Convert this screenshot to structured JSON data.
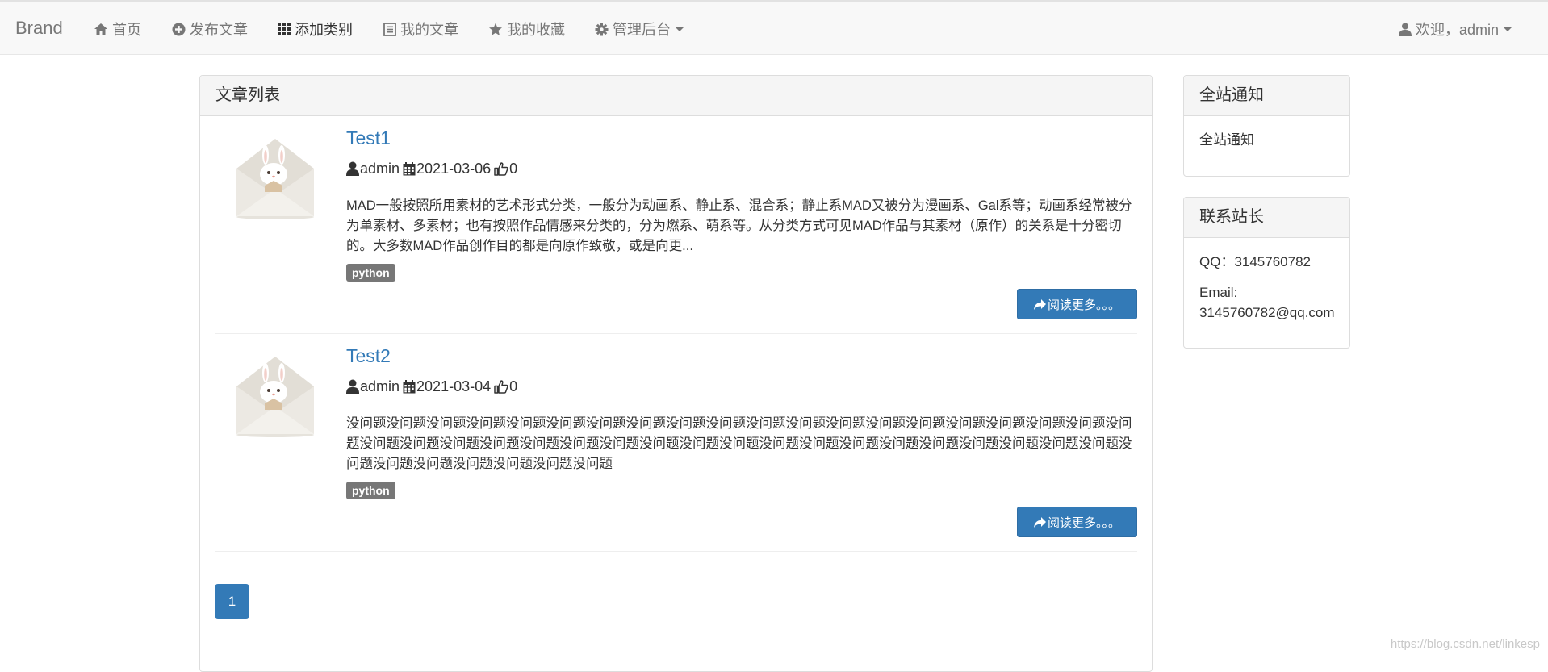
{
  "navbar": {
    "brand": "Brand",
    "items": [
      {
        "label": "首页",
        "icon": "home-icon"
      },
      {
        "label": "发布文章",
        "icon": "plus-circle-icon"
      },
      {
        "label": "添加类别",
        "icon": "grid-icon",
        "active": true
      },
      {
        "label": "我的文章",
        "icon": "list-alt-icon"
      },
      {
        "label": "我的收藏",
        "icon": "star-icon"
      },
      {
        "label": "管理后台",
        "icon": "cog-icon",
        "dropdown": true
      }
    ],
    "user": {
      "label": "欢迎，admin",
      "icon": "user-icon",
      "dropdown": true
    }
  },
  "main": {
    "panel_title": "文章列表",
    "articles": [
      {
        "title": "Test1",
        "author": "admin",
        "date": "2021-03-06",
        "likes": "0",
        "summary": "MAD一般按照所用素材的艺术形式分类，一般分为动画系、静止系、混合系；静止系MAD又被分为漫画系、Gal系等；动画系经常被分为单素材、多素材；也有按照作品情感来分类的，分为燃系、萌系等。从分类方式可见MAD作品与其素材（原作）的关系是十分密切的。大多数MAD作品创作目的都是向原作致敬，或是向更...",
        "tag": "python",
        "read_more": "阅读更多。。。"
      },
      {
        "title": "Test2",
        "author": "admin",
        "date": "2021-03-04",
        "likes": "0",
        "summary": "没问题没问题没问题没问题没问题没问题没问题没问题没问题没问题没问题没问题没问题没问题没问题没问题没问题没问题没问题没问题没问题没问题没问题没问题没问题没问题没问题没问题没问题没问题没问题没问题没问题没问题没问题没问题没问题没问题没问题没问题没问题没问题没问题没问题没问题没问题",
        "tag": "python",
        "read_more": "阅读更多。。。"
      }
    ],
    "pagination": {
      "current": "1"
    }
  },
  "sidebar": {
    "notice": {
      "title": "全站通知",
      "text": "全站通知"
    },
    "contact": {
      "title": "联系站长",
      "qq": "QQ：3145760782",
      "email_label": "Email:",
      "email": "3145760782@qq.com"
    }
  },
  "watermark": "https://blog.csdn.net/linkesp",
  "colors": {
    "primary": "#337ab7",
    "tag": "#777777",
    "navbar_bg": "#f8f8f8",
    "panel_heading_bg": "#f5f5f5"
  }
}
